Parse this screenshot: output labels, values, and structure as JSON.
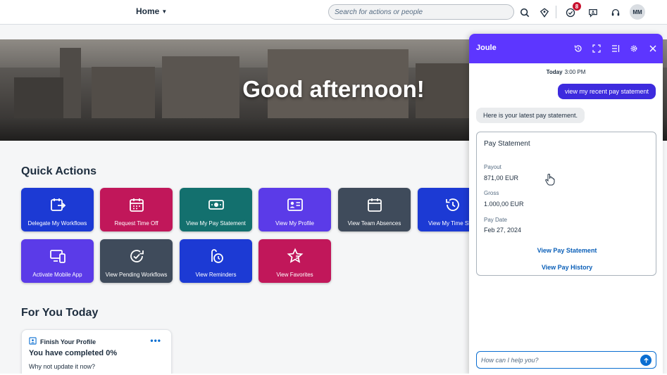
{
  "header": {
    "home_label": "Home",
    "search_placeholder": "Search for actions or people",
    "notifications_count": "8",
    "avatar_initials": "MM"
  },
  "hero": {
    "greeting": "Good afternoon!"
  },
  "quick_actions": {
    "title": "Quick Actions",
    "tiles": [
      {
        "label": "Delegate My Workflows",
        "color": "#1c3ad4",
        "icon": "delegate-workflow-icon"
      },
      {
        "label": "Request Time Off",
        "color": "#c1175a",
        "icon": "calendar-icon"
      },
      {
        "label": "View My Pay Statement",
        "color": "#13706e",
        "icon": "money-icon"
      },
      {
        "label": "View My Profile",
        "color": "#5b3be8",
        "icon": "profile-card-icon"
      },
      {
        "label": "View Team Absences",
        "color": "#3f4b5b",
        "icon": "calendar-icon"
      },
      {
        "label": "View My Time Sheet",
        "color": "#1c3ad4",
        "icon": "history-icon"
      },
      {
        "label": "Activate Mobile App",
        "color": "#5b3be8",
        "icon": "mobile-device-icon"
      },
      {
        "label": "View Pending Workflows",
        "color": "#3f4b5b",
        "icon": "pending-workflow-icon"
      },
      {
        "label": "View Reminders",
        "color": "#1c3ad4",
        "icon": "reminder-icon"
      },
      {
        "label": "View Favorites",
        "color": "#c1175a",
        "icon": "star-icon"
      }
    ]
  },
  "for_you": {
    "title": "For You Today",
    "card": {
      "heading": "Finish Your Profile",
      "main": "You have completed 0%",
      "sub": "Why not update it now?",
      "more": "•••"
    }
  },
  "joule": {
    "title": "Joule",
    "time_day": "Today",
    "time_clock": "3:00 PM",
    "user_message": "view my recent pay statement",
    "bot_message": "Here is your latest pay statement.",
    "pay_card": {
      "title": "Pay Statement",
      "payout_label": "Payout",
      "payout_value": "871,00 EUR",
      "gross_label": "Gross",
      "gross_value": "1.000,00 EUR",
      "paydate_label": "Pay Date",
      "paydate_value": "Feb 27, 2024",
      "link_statement": "View Pay Statement",
      "link_history": "View Pay History"
    },
    "input_placeholder": "How can I help you?"
  }
}
